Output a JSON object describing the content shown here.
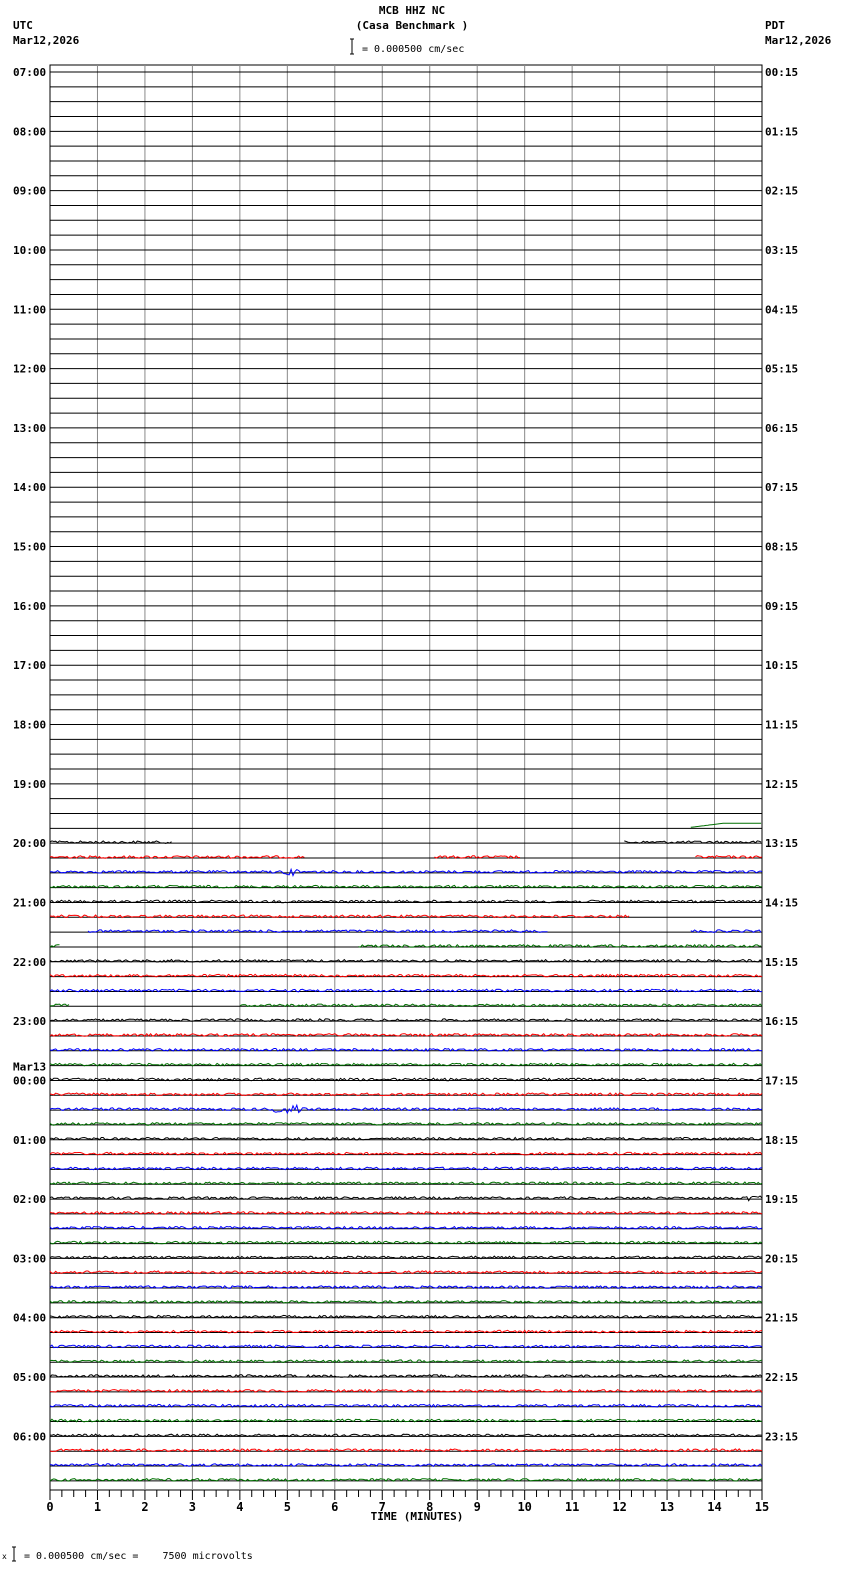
{
  "header": {
    "title": "MCB HHZ NC",
    "subtitle": "(Casa Benchmark )",
    "scale_text": "= 0.000500 cm/sec",
    "left_tz": "UTC",
    "left_date": "Mar12,2026",
    "right_tz": "PDT",
    "right_date": "Mar12,2026"
  },
  "footer": {
    "scale_prefix": "x",
    "scale_text": "= 0.000500 cm/sec =    7500 microvolts"
  },
  "chart_data": {
    "type": "line",
    "title": "MCB HHZ NC (Casa Benchmark )",
    "xlabel": "TIME (MINUTES)",
    "xlim": [
      0,
      15
    ],
    "x_ticks": [
      "0",
      "1",
      "2",
      "3",
      "4",
      "5",
      "6",
      "7",
      "8",
      "9",
      "10",
      "11",
      "12",
      "13",
      "14",
      "15"
    ],
    "rows_per_hour": 4,
    "trace_colors": [
      "#000000",
      "#ff0000",
      "#0000ff",
      "#007000"
    ],
    "left_labels": [
      "07:00",
      "08:00",
      "09:00",
      "10:00",
      "11:00",
      "12:00",
      "13:00",
      "14:00",
      "15:00",
      "16:00",
      "17:00",
      "18:00",
      "19:00",
      "20:00",
      "21:00",
      "22:00",
      "23:00",
      "00:00",
      "01:00",
      "02:00",
      "03:00",
      "04:00",
      "05:00",
      "06:00"
    ],
    "date_change_label": "Mar13",
    "right_labels": [
      "00:15",
      "01:15",
      "02:15",
      "03:15",
      "04:15",
      "05:15",
      "06:15",
      "07:15",
      "08:15",
      "09:15",
      "10:15",
      "11:15",
      "12:15",
      "13:15",
      "14:15",
      "15:15",
      "16:15",
      "17:15",
      "18:15",
      "19:15",
      "20:15",
      "21:15",
      "22:15",
      "23:15"
    ],
    "total_rows": 96,
    "data_start_row": 51,
    "segments": {
      "51": [
        [
          13.5,
          15
        ]
      ],
      "52": [
        [
          0,
          2.6
        ],
        [
          12.1,
          15
        ]
      ],
      "53": [
        [
          0,
          5.4
        ],
        [
          8.1,
          9.9
        ],
        [
          13.6,
          15
        ]
      ],
      "57": [
        [
          0,
          12.2
        ]
      ],
      "58": [
        [
          0.8,
          10.5
        ],
        [
          13.5,
          15
        ]
      ],
      "59": [
        [
          0,
          0.2
        ],
        [
          6.5,
          15
        ]
      ],
      "63": [
        [
          0,
          0.4
        ],
        [
          4,
          15
        ]
      ]
    },
    "events": [
      {
        "row": 54,
        "minute": 5.0,
        "amplitude": 4
      },
      {
        "row": 70,
        "minute": 5.0,
        "amplitude": 8
      },
      {
        "row": 51,
        "minute": 14.4,
        "amplitude": 8
      },
      {
        "row": 76,
        "minute": 14.9,
        "amplitude": 6
      }
    ]
  }
}
